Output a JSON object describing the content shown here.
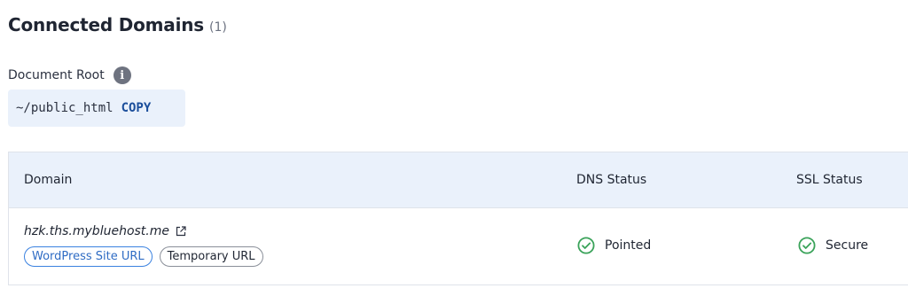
{
  "section": {
    "title": "Connected Domains",
    "count": "(1)"
  },
  "document_root": {
    "label": "Document Root",
    "info_icon": "info-icon",
    "path": "~/public_html",
    "copy_label": "COPY"
  },
  "table": {
    "headers": {
      "domain": "Domain",
      "dns": "DNS Status",
      "ssl": "SSL Status"
    },
    "rows": [
      {
        "domain": "hzk.ths.mybluehost.me",
        "external_icon": "external-link-icon",
        "tags": [
          "WordPress Site URL",
          "Temporary URL"
        ],
        "dns_status": "Pointed",
        "ssl_status": "Secure"
      }
    ]
  },
  "colors": {
    "accent": "#1b4e9b",
    "success": "#3aa35a",
    "header_bg": "#eaf1fb",
    "chip_blue": "#3b82e0"
  }
}
